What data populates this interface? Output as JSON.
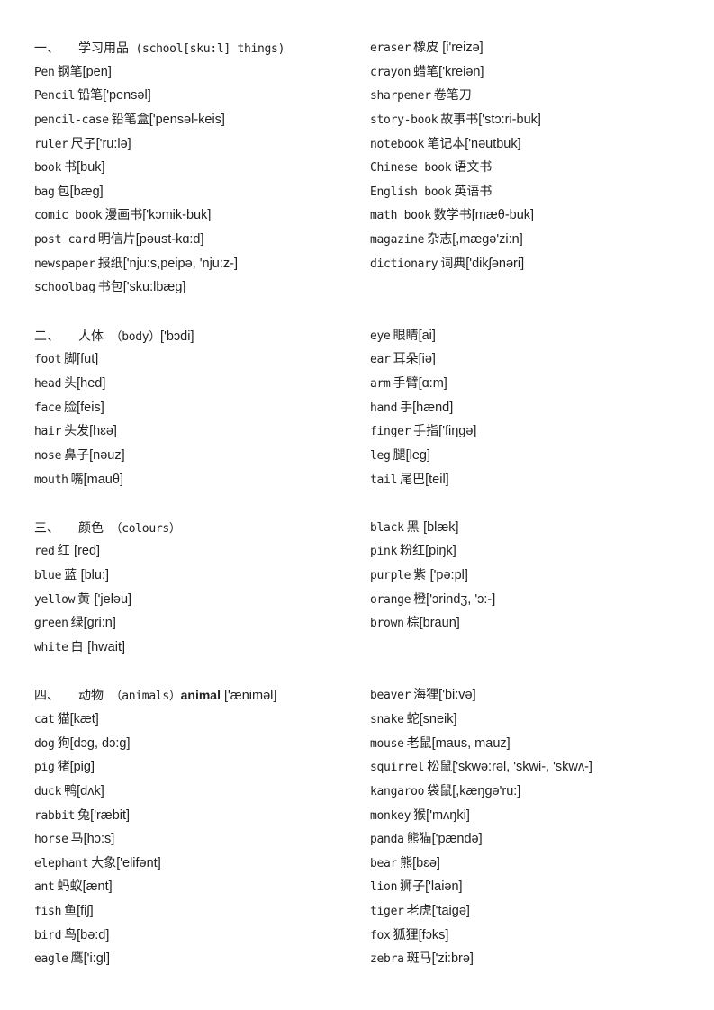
{
  "sections": [
    {
      "heading": {
        "num": "一、",
        "zh": "学习用品",
        "en": " (school[sku:l] things)",
        "bold": "",
        "ipa": ""
      },
      "left": [
        {
          "en": "Pen",
          "zh": "钢笔",
          "ipa": "[pen]"
        },
        {
          "en": "Pencil",
          "zh": "铅笔",
          "ipa": "['pensəl]"
        },
        {
          "en": "pencil-case",
          "zh": "铅笔盒",
          "ipa": "['pensəl-keis]"
        },
        {
          "en": "ruler",
          "zh": "尺子",
          "ipa": "['ru:lə]"
        },
        {
          "en": "book",
          "zh": "书",
          "ipa": "[buk]"
        },
        {
          "en": "bag",
          "zh": "包",
          "ipa": "[bæg]"
        },
        {
          "en": "comic book",
          "zh": "漫画书",
          "ipa": "['kɔmik-buk]"
        },
        {
          "en": "post card",
          "zh": "明信片",
          "ipa": "[pəust-kɑ:d]"
        },
        {
          "en": "newspaper",
          "zh": "报纸",
          "ipa": "['nju:s,peipə, 'nju:z-]"
        },
        {
          "en": "schoolbag",
          "zh": "书包",
          "ipa": "['sku:lbæg]"
        }
      ],
      "right": [
        {
          "en": "eraser",
          "zh": "橡皮",
          "ipa": " [i'reizə]"
        },
        {
          "en": "crayon",
          "zh": "蜡笔",
          "ipa": "['kreiən]"
        },
        {
          "en": "sharpener",
          "zh": "卷笔刀",
          "ipa": ""
        },
        {
          "en": "story-book",
          "zh": "故事书",
          "ipa": "['stɔ:ri-buk]"
        },
        {
          "en": "notebook",
          "zh": "笔记本",
          "ipa": "['nəutbuk]"
        },
        {
          "en": "Chinese book",
          "zh": "语文书",
          "ipa": ""
        },
        {
          "en": "English book",
          "zh": "英语书",
          "ipa": ""
        },
        {
          "en": "math book",
          "zh": "数学书",
          "ipa": "[mæθ-buk]"
        },
        {
          "en": "magazine",
          "zh": "杂志",
          "ipa": "[,mægə'zi:n]"
        },
        {
          "en": "dictionary",
          "zh": "词典",
          "ipa": "['dikʃənəri]"
        }
      ]
    },
    {
      "heading": {
        "num": "二、",
        "zh": "人体",
        "en": " （body）",
        "bold": "",
        "ipa": "['bɔdi]"
      },
      "left": [
        {
          "en": "foot",
          "zh": "脚",
          "ipa": "[fut]"
        },
        {
          "en": "head",
          "zh": "头",
          "ipa": "[hed]"
        },
        {
          "en": "face",
          "zh": "脸",
          "ipa": "[feis]"
        },
        {
          "en": "hair",
          "zh": "头发",
          "ipa": "[hɛə]"
        },
        {
          "en": "nose",
          "zh": "鼻子",
          "ipa": "[nəuz]"
        },
        {
          "en": "mouth",
          "zh": "嘴",
          "ipa": "[mauθ]"
        }
      ],
      "right": [
        {
          "en": "eye",
          "zh": "眼睛",
          "ipa": "[ai]"
        },
        {
          "en": "ear",
          "zh": "耳朵",
          "ipa": "[iə]"
        },
        {
          "en": "arm",
          "zh": "手臂",
          "ipa": "[ɑ:m]"
        },
        {
          "en": "hand",
          "zh": "手",
          "ipa": "[hænd]"
        },
        {
          "en": "finger",
          "zh": "手指",
          "ipa": "['fiŋgə]"
        },
        {
          "en": "leg",
          "zh": "腿",
          "ipa": "[leg]"
        },
        {
          "en": "tail",
          "zh": "尾巴",
          "ipa": "[teil]"
        }
      ]
    },
    {
      "heading": {
        "num": "三、",
        "zh": "颜色",
        "en": " （colours）",
        "bold": "",
        "ipa": ""
      },
      "left": [
        {
          "en": "red",
          "zh": "红 ",
          "ipa": "[red]"
        },
        {
          "en": "blue",
          "zh": "蓝 ",
          "ipa": "[blu:]"
        },
        {
          "en": "yellow",
          "zh": "黄 ",
          "ipa": "['jeləu]"
        },
        {
          "en": "green",
          "zh": "绿",
          "ipa": "[gri:n]"
        },
        {
          "en": "white",
          "zh": "白 ",
          "ipa": "[hwait]"
        }
      ],
      "right": [
        {
          "en": "black",
          "zh": "黑 ",
          "ipa": "[blæk]"
        },
        {
          "en": "pink",
          "zh": "粉红",
          "ipa": "[piŋk]"
        },
        {
          "en": "purple",
          "zh": "紫 ",
          "ipa": "['pə:pl]"
        },
        {
          "en": "orange",
          "zh": "橙",
          "ipa": "['ɔrindʒ, 'ɔ:-]"
        },
        {
          "en": "brown",
          "zh": "棕",
          "ipa": "[braun]"
        }
      ]
    },
    {
      "heading": {
        "num": "四、",
        "zh": "动物",
        "en": " （animals）",
        "bold": "animal",
        "ipa": " ['æniməl]"
      },
      "left": [
        {
          "en": "cat",
          "zh": "猫",
          "ipa": "[kæt]"
        },
        {
          "en": "dog",
          "zh": "狗",
          "ipa": "[dɔg, dɔ:g]"
        },
        {
          "en": "pig",
          "zh": "猪",
          "ipa": "[pig]"
        },
        {
          "en": "duck",
          "zh": "鸭",
          "ipa": "[dʌk]"
        },
        {
          "en": "rabbit",
          "zh": "兔",
          "ipa": "['ræbit]"
        },
        {
          "en": "horse",
          "zh": "马",
          "ipa": "[hɔ:s]"
        },
        {
          "en": "elephant",
          "zh": "大象",
          "ipa": "['elifənt]"
        },
        {
          "en": "ant",
          "zh": "蚂蚁",
          "ipa": "[ænt]"
        },
        {
          "en": "fish",
          "zh": "鱼",
          "ipa": "[fiʃ]"
        },
        {
          "en": "bird",
          "zh": "鸟",
          "ipa": "[bə:d]"
        },
        {
          "en": "eagle",
          "zh": "鹰",
          "ipa": "['i:gl]"
        }
      ],
      "right": [
        {
          "en": "beaver",
          "zh": "海狸",
          "ipa": "['bi:və]"
        },
        {
          "en": "snake",
          "zh": "蛇",
          "ipa": "[sneik]"
        },
        {
          "en": "mouse",
          "zh": "老鼠",
          "ipa": "[maus, mauz]"
        },
        {
          "en": "squirrel",
          "zh": "松鼠",
          "ipa": "['skwə:rəl, 'skwi-, 'skwʌ-]"
        },
        {
          "en": "kangaroo",
          "zh": "袋鼠",
          "ipa": "[,kæŋgə'ru:]"
        },
        {
          "en": "monkey",
          "zh": "猴",
          "ipa": "['mʌŋki]"
        },
        {
          "en": "panda",
          "zh": "熊猫",
          "ipa": "['pændə]"
        },
        {
          "en": "bear",
          "zh": "熊",
          "ipa": "[bɛə]"
        },
        {
          "en": "lion",
          "zh": "狮子",
          "ipa": "['laiən]"
        },
        {
          "en": "tiger",
          "zh": "老虎",
          "ipa": "['taigə]"
        },
        {
          "en": "fox",
          "zh": "狐狸",
          "ipa": "[fɔks]"
        },
        {
          "en": "zebra",
          "zh": "斑马",
          "ipa": "['zi:brə]"
        }
      ]
    }
  ]
}
